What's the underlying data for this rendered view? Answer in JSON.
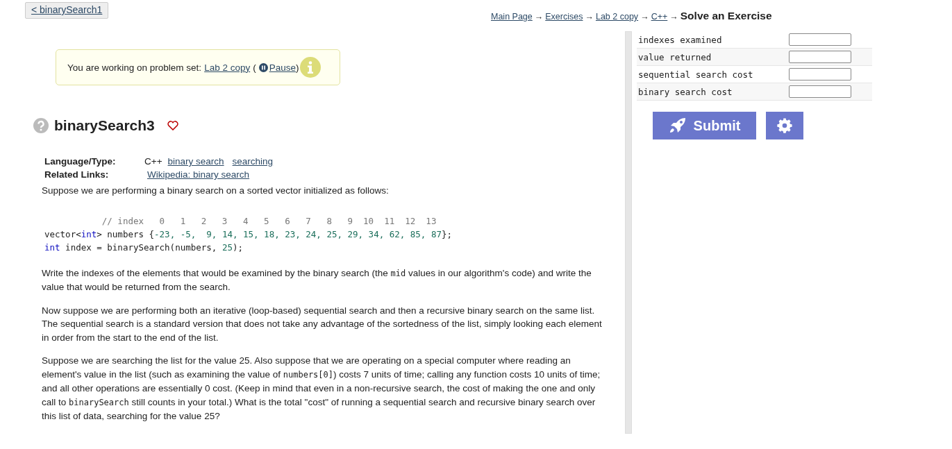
{
  "back_link": "< binarySearch1",
  "breadcrumb": {
    "links": [
      "Main Page",
      "Exercises",
      "Lab 2 copy",
      "C++"
    ],
    "separator": "→",
    "current": "Solve an Exercise"
  },
  "notice": {
    "text": "You are working on problem set:",
    "link": "Lab 2 copy",
    "pause": "Pause",
    "open": "(",
    "close": ")"
  },
  "problem": {
    "title": "binarySearch3",
    "favorite": false
  },
  "meta": [
    {
      "label": "Language/Type:",
      "plain": "C++",
      "links": [
        "binary search",
        "searching"
      ]
    },
    {
      "label": "Related Links:",
      "links": [
        "Wikipedia: binary search"
      ]
    }
  ],
  "intro": "Suppose we are performing a binary search on a sorted vector initialized as follows:",
  "code": [
    [
      {
        "kind": "comment",
        "text": "// index   0   1   2   3   4   5   6   7   8   9  10  11  12  13"
      }
    ],
    [
      {
        "kind": "plain",
        "text": "vector<"
      },
      {
        "kind": "keyword",
        "text": "int"
      },
      {
        "kind": "plain",
        "text": "> numbers {"
      },
      {
        "kind": "number",
        "text": "-23, -5,  9, 14, 15, 18, 23, 24, 25, 29, 34, 62, 85, 87"
      },
      {
        "kind": "plain",
        "text": "};"
      }
    ],
    [
      {
        "kind": "keyword",
        "text": "int"
      },
      {
        "kind": "plain",
        "text": " index = binarySearch(numbers, "
      },
      {
        "kind": "number",
        "text": "25"
      },
      {
        "kind": "plain",
        "text": ");"
      }
    ]
  ],
  "paragraphs": [
    [
      {
        "kind": "text",
        "text": "Write the indexes of the elements that would be examined by the binary search (the "
      },
      {
        "kind": "code",
        "text": "mid"
      },
      {
        "kind": "text",
        "text": " values in our algorithm's code) and write the value that would be returned from the search."
      }
    ],
    [
      {
        "kind": "text",
        "text": "Now suppose we are performing both an iterative (loop-based) sequential search and then a recursive binary search on the same list. The sequential search is a standard version that does not take any advantage of the sortedness of the list, simply looking each element in order from the start to the end of the list."
      }
    ],
    [
      {
        "kind": "text",
        "text": "Suppose we are searching the list for the value 25. Also suppose that we are operating on a special computer where reading an element's value in the list (such as examining the value of "
      },
      {
        "kind": "code",
        "text": "numbers[0]"
      },
      {
        "kind": "text",
        "text": ") costs 7 units of time; calling any function costs 10 units of time; and all other operations are essentially 0 cost. (Keep in mind that even in a non-recursive search, the cost of making the one and only call to "
      },
      {
        "kind": "code",
        "text": "binarySearch"
      },
      {
        "kind": "text",
        "text": " still counts in your total.) What is the total \"cost\" of running a sequential search and recursive binary search over this list of data, searching for the value 25?"
      }
    ]
  ],
  "answers": [
    {
      "label": "indexes examined"
    },
    {
      "label": "value returned"
    },
    {
      "label": "sequential search cost"
    },
    {
      "label": "binary search cost"
    }
  ],
  "submit": "Submit"
}
